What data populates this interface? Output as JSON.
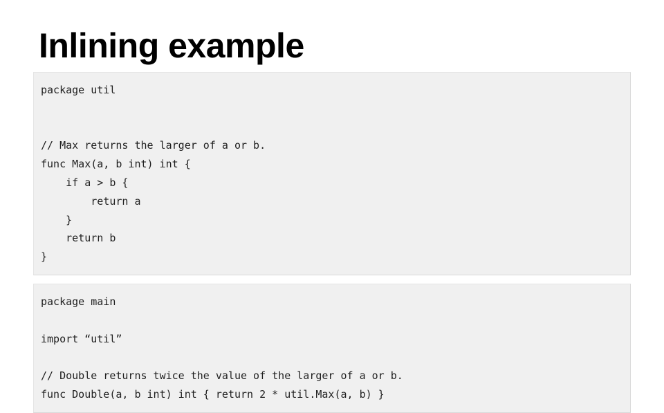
{
  "slide": {
    "title": "Inlining example",
    "background_color": "#ffffff",
    "title_color": "#000000"
  },
  "code_blocks": [
    {
      "name": "util-package-code-block",
      "language": "go",
      "background_color": "#f0f0f0",
      "border_color": "#e4e4e4",
      "text_color": "#1f1f1f",
      "lines": [
        "package util",
        "",
        "",
        "// Max returns the larger of a or b.",
        "func Max(a, b int) int {",
        "    if a > b {",
        "        return a",
        "    }",
        "    return b",
        "}"
      ]
    },
    {
      "name": "main-package-code-block",
      "language": "go",
      "background_color": "#f0f0f0",
      "border_color": "#e4e4e4",
      "text_color": "#1f1f1f",
      "lines": [
        "package main",
        "",
        "import “util”",
        "",
        "// Double returns twice the value of the larger of a or b.",
        "func Double(a, b int) int { return 2 * util.Max(a, b) }"
      ]
    }
  ]
}
